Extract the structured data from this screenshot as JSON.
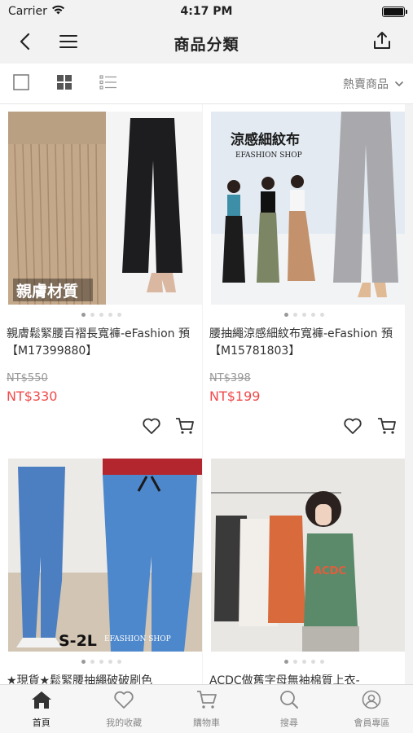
{
  "status_bar": {
    "carrier": "Carrier",
    "time": "4:17 PM",
    "battery_level": 1.0
  },
  "nav": {
    "title": "商品分類",
    "back_icon": "chevron-left-icon",
    "menu_icon": "hamburger-menu-icon",
    "share_icon": "share-icon"
  },
  "toolbar": {
    "view_modes": [
      "single-view-icon",
      "grid-view-icon",
      "list-view-icon"
    ],
    "selected_view": "grid-view-icon",
    "sort_label": "熱賣商品"
  },
  "products": [
    {
      "title": "親膚鬆緊腰百褶長寬褲-eFashion 預【M17399880】",
      "original_price": "NT$550",
      "price": "NT$330",
      "image_text": "親膚材質",
      "image_count": 5,
      "image_index": 1
    },
    {
      "title": "腰抽繩涼感細紋布寬褲-eFashion 預【M15781803】",
      "original_price": "NT$398",
      "price": "NT$199",
      "image_text": "涼感細紋布",
      "image_subtext": "EFASHION SHOP",
      "image_count": 5,
      "image_index": 1
    },
    {
      "title": "★現貨★鬆緊腰抽繩破破刷色",
      "image_text": "S-2L",
      "image_subtext": "EFASHION SHOP",
      "image_count": 5,
      "image_index": 1
    },
    {
      "title": "ACDC做舊字母無袖棉質上衣-",
      "image_text": "ACDC",
      "image_count": 5,
      "image_index": 1
    }
  ],
  "tabs": [
    {
      "label": "首頁",
      "icon": "home-icon",
      "active": true
    },
    {
      "label": "我的收藏",
      "icon": "heart-icon",
      "active": false
    },
    {
      "label": "購物車",
      "icon": "cart-icon",
      "active": false
    },
    {
      "label": "搜尋",
      "icon": "search-icon",
      "active": false
    },
    {
      "label": "會員專區",
      "icon": "member-icon",
      "active": false
    }
  ],
  "colors": {
    "price_red": "#f04b4b",
    "bar_bg": "#f2f2f2",
    "grid_bg": "#f3f3f3"
  }
}
